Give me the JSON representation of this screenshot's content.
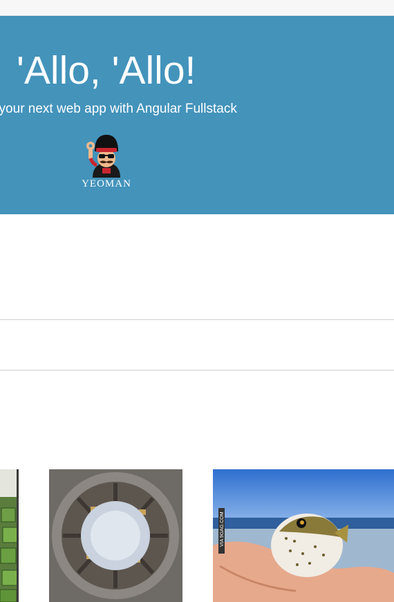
{
  "hero": {
    "title": "'Allo, 'Allo!",
    "lead": "t your next web app with Angular Fullstack",
    "logo": {
      "label": "YEOMAN",
      "icon": "yeoman-mascot-icon"
    },
    "background_color": "#4393bb"
  },
  "gallery": {
    "items": [
      {
        "icon": "square-watermelons-photo",
        "alt": "square watermelons"
      },
      {
        "icon": "tiny-planet-city-photo",
        "alt": "tiny planet city street"
      },
      {
        "icon": "pufferfish-in-hand-photo",
        "alt": "pufferfish held in hand",
        "watermark": "VIA 9GAG.COM"
      }
    ]
  }
}
